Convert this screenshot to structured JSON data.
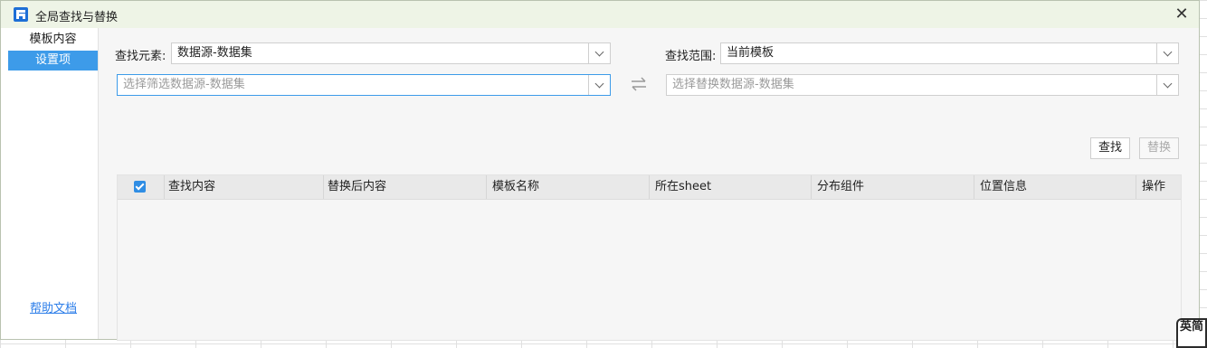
{
  "window": {
    "title": "全局查找与替换",
    "close_symbol": "✕"
  },
  "sidebar": {
    "items": [
      {
        "label": "模板内容",
        "active": false
      },
      {
        "label": "设置项",
        "active": true
      }
    ],
    "help_link": "帮助文档"
  },
  "search": {
    "element_label": "查找元素:",
    "element_value": "数据源-数据集",
    "scope_label": "查找范围:",
    "scope_value": "当前模板",
    "filter_placeholder": "选择筛选数据源-数据集",
    "replace_placeholder": "选择替换数据源-数据集",
    "find_button": "查找",
    "replace_button": "替换"
  },
  "table": {
    "select_all_checked": true,
    "columns": [
      "查找内容",
      "替换后内容",
      "模板名称",
      "所在sheet",
      "分布组件",
      "位置信息",
      "操作"
    ],
    "rows": []
  },
  "ime": {
    "label": "英简"
  },
  "colors": {
    "accent": "#3d9be9",
    "titlebar": "#eef4e6"
  }
}
